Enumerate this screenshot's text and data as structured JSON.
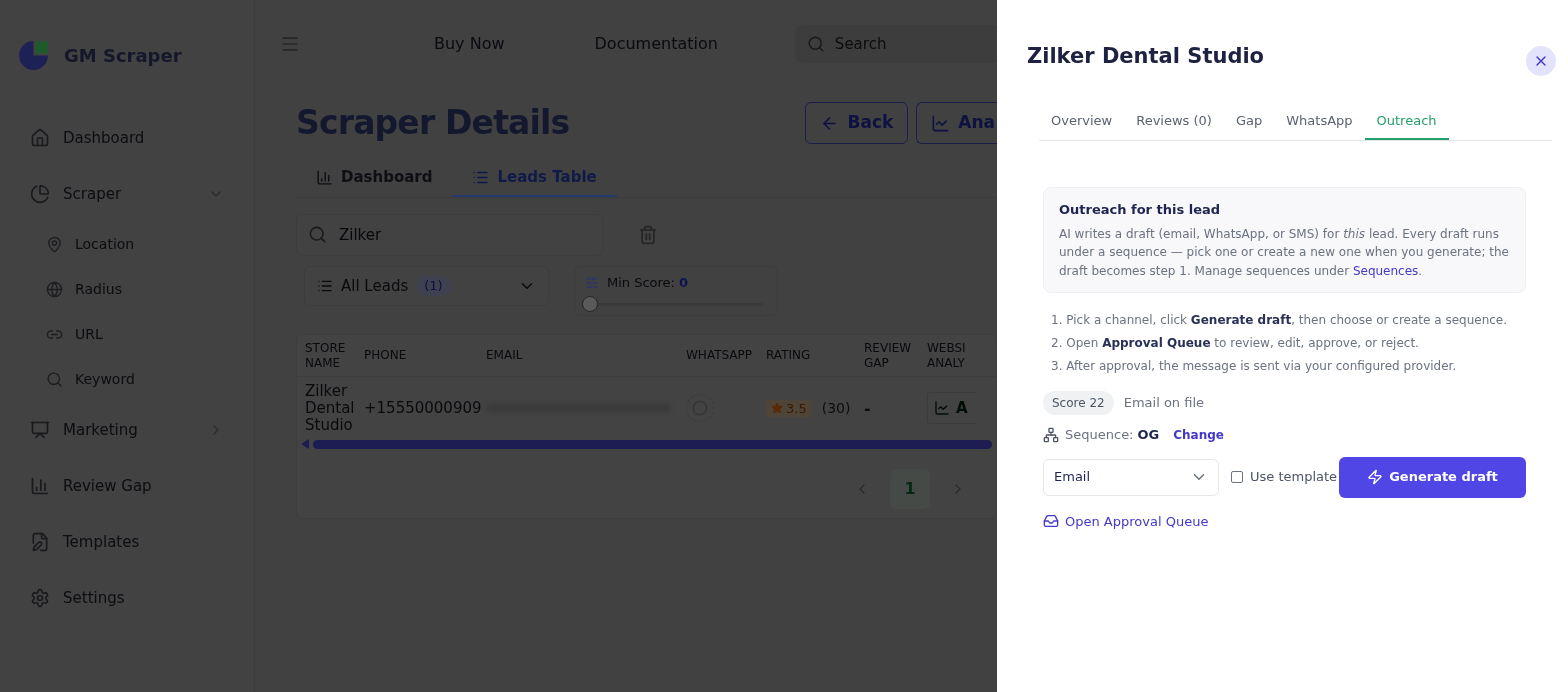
{
  "brand": {
    "name": "GM Scraper"
  },
  "sidebar": {
    "items": [
      {
        "label": "Dashboard",
        "kind": "item"
      },
      {
        "label": "Scraper",
        "kind": "group",
        "expanded": true,
        "children": [
          {
            "label": "Location"
          },
          {
            "label": "Radius"
          },
          {
            "label": "URL"
          },
          {
            "label": "Keyword"
          }
        ]
      },
      {
        "label": "Marketing",
        "kind": "group",
        "expanded": false
      },
      {
        "label": "Review Gap",
        "kind": "item"
      },
      {
        "label": "Templates",
        "kind": "item"
      },
      {
        "label": "Settings",
        "kind": "item"
      }
    ]
  },
  "top_nav": {
    "links": [
      "Buy Now",
      "Documentation"
    ],
    "search": {
      "placeholder": "Search"
    }
  },
  "page": {
    "title": "Scraper Details",
    "buttons": [
      "Back",
      "Ana"
    ],
    "tabs": [
      {
        "label": "Dashboard",
        "selected": false
      },
      {
        "label": "Leads Table",
        "selected": true
      }
    ],
    "search": {
      "value": "Zilker"
    },
    "filter": {
      "label": "All Leads",
      "count": "(1)"
    },
    "min_score": {
      "label": "Min Score:",
      "value": "0",
      "level": 0
    },
    "table": {
      "columns": [
        "STORE NAME",
        "PHONE",
        "EMAIL",
        "WHATSAPP",
        "RATING",
        "REVIEW GAP",
        "WEBSI ANALY"
      ],
      "rows": [
        {
          "store_name": "Zilker Dental Studio",
          "phone": "+15550000909",
          "rating": "3.5",
          "rating_count": "(30)",
          "review_gap": "-",
          "website_analysis": "A"
        }
      ]
    },
    "pagination": {
      "pages": [
        {
          "label": "1",
          "selected": true
        }
      ]
    }
  },
  "drawer": {
    "title": "Zilker Dental Studio",
    "tabs": [
      {
        "label": "Overview",
        "selected": false
      },
      {
        "label": "Reviews (0)",
        "selected": false
      },
      {
        "label": "Gap",
        "selected": false
      },
      {
        "label": "WhatsApp",
        "selected": false
      },
      {
        "label": "Outreach",
        "selected": true
      }
    ],
    "info": {
      "heading": "Outreach for this lead",
      "text": "AI writes a draft (email, WhatsApp, or SMS) for *this* lead. Every draft runs under a sequence — pick one or create a new one when you generate; the draft becomes step 1. Manage sequences under ",
      "link": "Sequences",
      "text_end": "."
    },
    "steps": [
      "1. Pick a channel, click **Generate draft**, then choose or create a sequence.",
      "2. Open **Approval Queue** to review, edit, approve, or reject.",
      "3. After approval, the message is sent via your configured provider."
    ],
    "score": "Score 22",
    "contact": "Email on file",
    "sequence": {
      "label": "Sequence:",
      "value": "OG",
      "action": "Change"
    },
    "channel": {
      "value": "Email"
    },
    "use_template": {
      "label": "Use template",
      "checked": false
    },
    "generate_button": "Generate draft",
    "queue_link": "Open Approval Queue"
  }
}
